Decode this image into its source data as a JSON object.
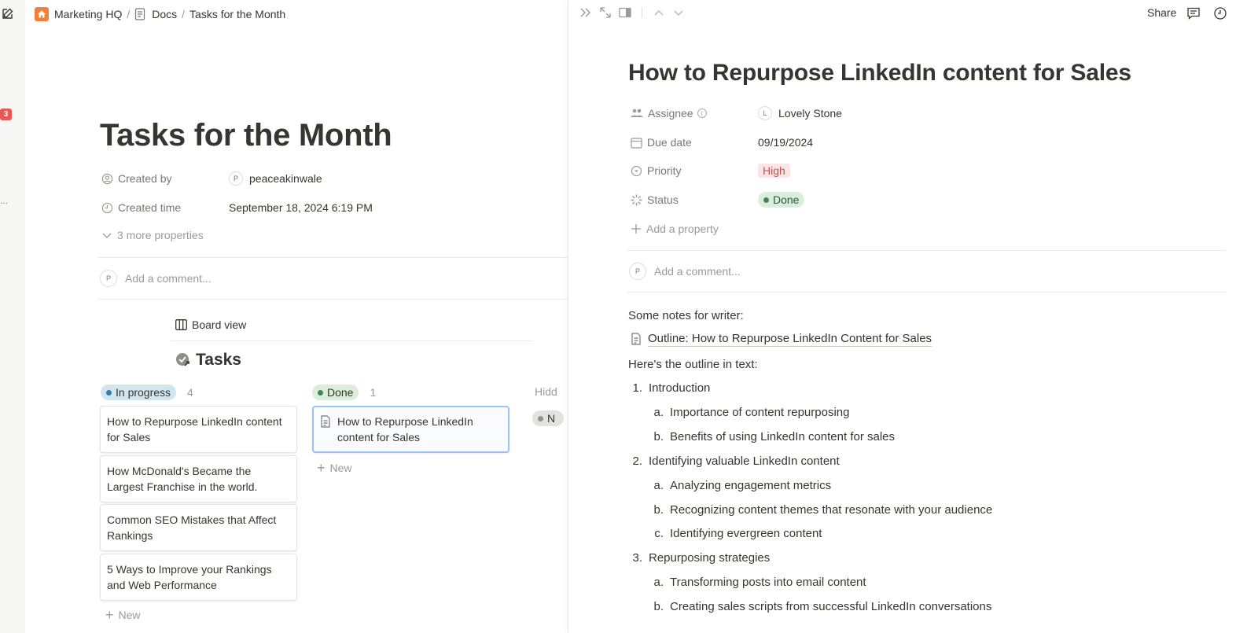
{
  "sidebar": {
    "badge_count": "3",
    "more": "..."
  },
  "breadcrumb": {
    "workspace": "Marketing HQ",
    "sep1": "/",
    "docs": "Docs",
    "sep2": "/",
    "page": "Tasks for the Month"
  },
  "page": {
    "title": "Tasks for the Month",
    "props": {
      "created_by_label": "Created by",
      "created_by_initial": "P",
      "created_by_value": "peaceakinwale",
      "created_time_label": "Created time",
      "created_time_value": "September 18, 2024 6:19 PM",
      "more_props": "3 more properties"
    },
    "comment": {
      "initial": "P",
      "placeholder": "Add a comment..."
    }
  },
  "database": {
    "view_label": "Board view",
    "title": "Tasks",
    "groups": [
      {
        "name": "In progress",
        "count": "4",
        "color": "#d3e5ef",
        "dot": "#337ea9",
        "cards": [
          "How to Repurpose LinkedIn content for Sales",
          "How McDonald's Became the Largest Franchise in the world.",
          "Common SEO Mistakes that Affect Rankings",
          "5 Ways to Improve your Rankings and Web Performance"
        ],
        "new_label": "New"
      },
      {
        "name": "Done",
        "count": "1",
        "color": "#dbeddb",
        "dot": "#448361",
        "cards": [
          "How to Repurpose LinkedIn content for Sales"
        ],
        "new_label": "New"
      }
    ],
    "hidden_label": "Hidd",
    "hidden_pill": "N"
  },
  "peek": {
    "share_label": "Share",
    "title": "How to Repurpose LinkedIn content for Sales",
    "props": {
      "assignee_label": "Assignee",
      "assignee_initial": "L",
      "assignee_value": "Lovely Stone",
      "due_label": "Due date",
      "due_value": "09/19/2024",
      "priority_label": "Priority",
      "priority_value": "High",
      "status_label": "Status",
      "status_value": "Done",
      "add_property": "Add a property"
    },
    "comment": {
      "initial": "P",
      "placeholder": "Add a comment..."
    },
    "content": {
      "notes": "Some notes for writer:",
      "link": "Outline: How to Repurpose LinkedIn Content for Sales",
      "outline_intro": "Here's the outline in text:",
      "items": [
        {
          "num": "1.",
          "text": "Introduction"
        },
        {
          "num": "a.",
          "text": "Importance of content repurposing"
        },
        {
          "num": "b.",
          "text": "Benefits of using LinkedIn content for sales"
        },
        {
          "num": "2.",
          "text": "Identifying valuable LinkedIn content"
        },
        {
          "num": "a.",
          "text": "Analyzing engagement metrics"
        },
        {
          "num": "b.",
          "text": "Recognizing content themes that resonate with your audience"
        },
        {
          "num": "c.",
          "text": "Identifying evergreen content"
        },
        {
          "num": "3.",
          "text": "Repurposing strategies"
        },
        {
          "num": "a.",
          "text": "Transforming posts into email content"
        },
        {
          "num": "b.",
          "text": "Creating sales scripts from successful LinkedIn conversations"
        }
      ]
    }
  }
}
